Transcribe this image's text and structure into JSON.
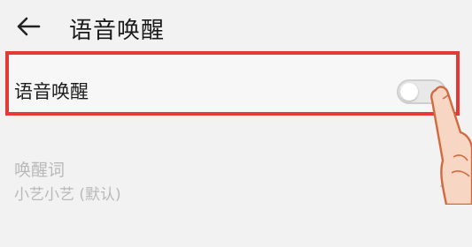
{
  "header": {
    "title": "语音唤醒",
    "back_icon": "arrow-left-icon"
  },
  "voice_wake": {
    "label": "语音唤醒",
    "toggle_on": false
  },
  "wake_word": {
    "label": "唤醒词",
    "value": "小艺小艺 (默认)",
    "chevron_icon": "chevron-right-icon"
  },
  "colors": {
    "highlight": "#e53935",
    "background": "#f2f2f2",
    "disabled_text": "#b9b9b9"
  }
}
